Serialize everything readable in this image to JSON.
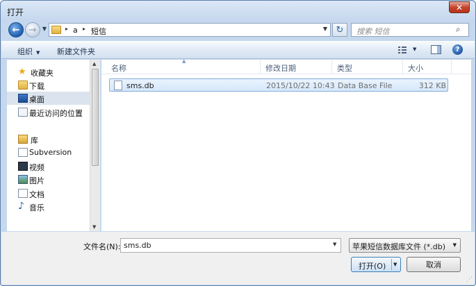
{
  "window": {
    "title": "打开",
    "close_glyph": "✕"
  },
  "address": {
    "root_arrow": "▸",
    "crumbs": [
      "a",
      "短信"
    ],
    "refresh_glyph": "↻"
  },
  "search": {
    "placeholder": "搜索 短信"
  },
  "toolbar": {
    "organize": "组织",
    "new_folder": "新建文件夹",
    "help_glyph": "?"
  },
  "nav": {
    "items": [
      {
        "label": "收藏夹",
        "icon": "star-icon"
      },
      {
        "label": "下载",
        "icon": "download-folder-icon"
      },
      {
        "label": "桌面",
        "icon": "desktop-icon"
      },
      {
        "label": "最近访问的位置",
        "icon": "recent-places-icon"
      },
      {
        "label": "库",
        "icon": "library-icon"
      },
      {
        "label": "Subversion",
        "icon": "subversion-icon"
      },
      {
        "label": "视频",
        "icon": "video-icon"
      },
      {
        "label": "图片",
        "icon": "picture-icon"
      },
      {
        "label": "文档",
        "icon": "document-icon"
      },
      {
        "label": "音乐",
        "icon": "music-icon"
      }
    ],
    "selected": "桌面"
  },
  "columns": {
    "name": "名称",
    "modified": "修改日期",
    "type": "类型",
    "size": "大小"
  },
  "files": [
    {
      "name": "sms.db",
      "modified": "2015/10/22 10:43",
      "type": "Data Base File",
      "size": "312 KB"
    }
  ],
  "bottom": {
    "filename_label": "文件名(N):",
    "filename_value": "sms.db",
    "filetype_value": "苹果短信数据库文件 (*.db)",
    "open_label": "打开(O)",
    "cancel_label": "取消"
  },
  "colors": {
    "accent": "#3c7fb1",
    "selection": "#d6e8fb",
    "frame": "#c5d8ee"
  }
}
